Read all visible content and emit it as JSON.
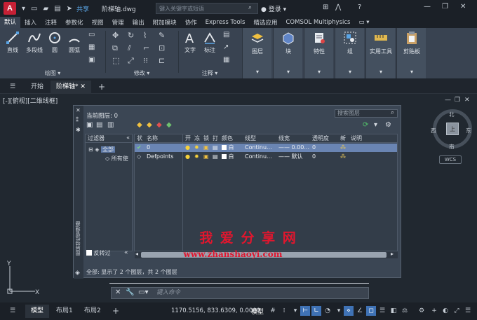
{
  "app": {
    "logo": "A",
    "share": "共享",
    "doc_title": "阶梯轴.dwg",
    "search_placeholder": "键入关键字或短语",
    "login": "登录"
  },
  "menu_tabs": [
    "默认",
    "插入",
    "注释",
    "参数化",
    "视图",
    "管理",
    "输出",
    "附加模块",
    "协作",
    "Express Tools",
    "精选应用",
    "COMSOL Multiphysics"
  ],
  "ribbon": {
    "draw_buttons": [
      "直线",
      "多段线",
      "圆",
      "圆弧"
    ],
    "draw_title": "绘图",
    "modify_title": "修改",
    "annot_buttons": [
      "文字",
      "标注"
    ],
    "annot_title": "注释",
    "panels": [
      "图层",
      "块",
      "特性",
      "组",
      "实用工具",
      "剪贴板"
    ]
  },
  "file_tabs": {
    "start": "开始",
    "current": "阶梯轴*",
    "add": "+"
  },
  "viewport": {
    "label": "[-][俯视][二维线框]",
    "compass": {
      "n": "北",
      "s": "南",
      "w": "西",
      "e": "东",
      "top": "上"
    },
    "wcs": "WCS"
  },
  "palette": {
    "strip_title": "图层特性管理器",
    "current_layer": "当前图层: 0",
    "search_placeholder": "搜索图层",
    "filters_header": "过滤器",
    "tree": [
      "全部",
      "所有使"
    ],
    "invert_label": "反转过",
    "status": "全部: 显示了 2 个图层，共 2 个图层",
    "columns": [
      "状",
      "名称",
      "开",
      "冻",
      "锁",
      "打",
      "颜色",
      "线型",
      "线宽",
      "透明度",
      "新",
      "说明"
    ],
    "layers": [
      {
        "name": "0",
        "color": "白",
        "linetype": "Continu...",
        "lineweight": "—— 0.00...",
        "transparency": "0",
        "selected": true
      },
      {
        "name": "Defpoints",
        "color": "白",
        "linetype": "Continu...",
        "lineweight": "—— 默认",
        "transparency": "0",
        "selected": false
      }
    ]
  },
  "watermark": {
    "line1": "我 爱 分 享 网",
    "line2": "www.zhanshaoyi.com"
  },
  "command": {
    "placeholder": "键入命令"
  },
  "status": {
    "tabs": [
      "模型",
      "布局1",
      "布局2"
    ],
    "add": "+",
    "coords": "1170.5156, 833.6309, 0.0000",
    "mode": "模型"
  }
}
